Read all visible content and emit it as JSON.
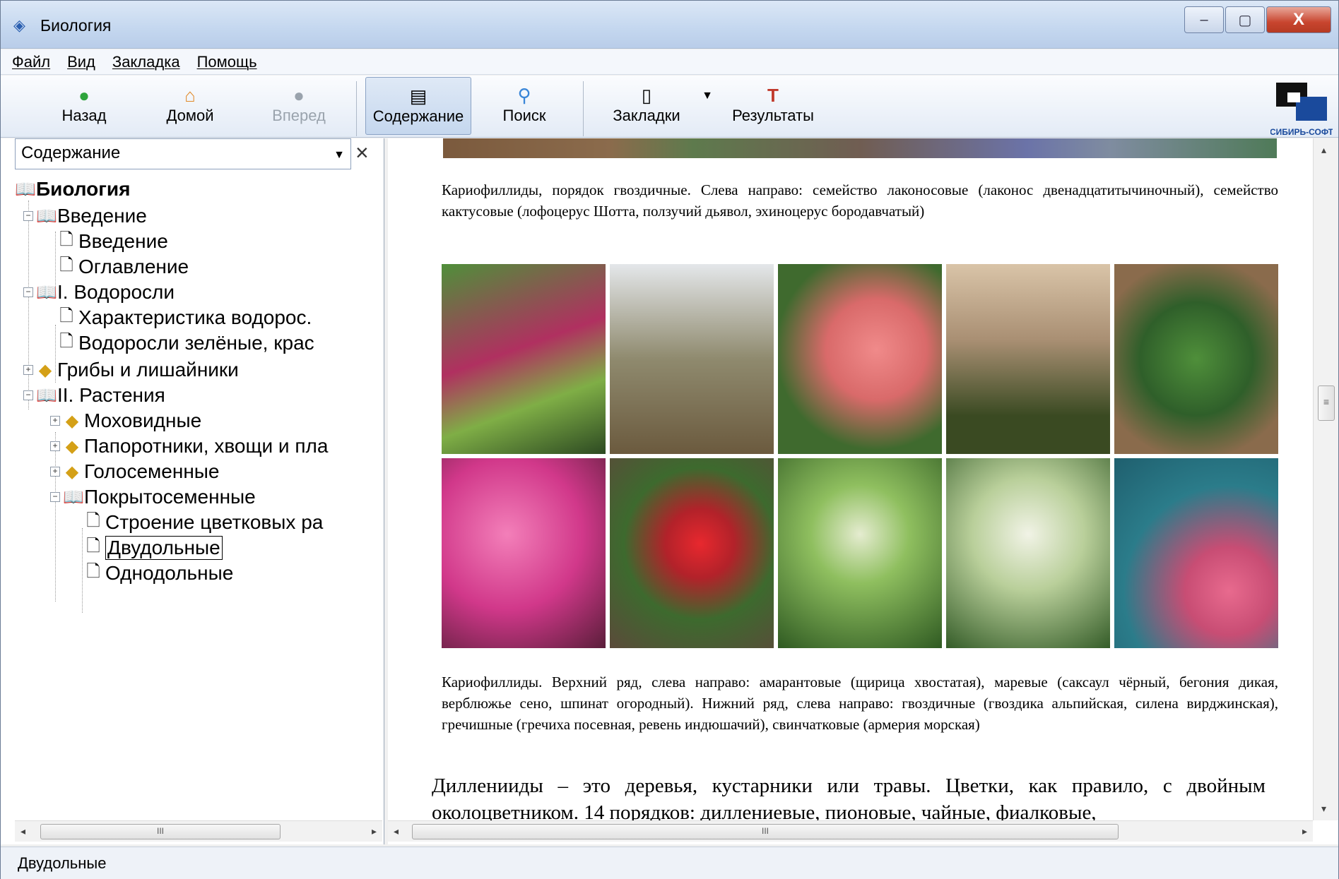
{
  "window": {
    "title": "Биология",
    "buttons": {
      "minimize": "–",
      "maximize": "▢",
      "close": "X"
    }
  },
  "menu": [
    "Файл",
    "Вид",
    "Закладка",
    "Помощь"
  ],
  "toolbar": {
    "back": "Назад",
    "home": "Домой",
    "forward": "Вперед",
    "contents": "Содержание",
    "search": "Поиск",
    "bookmarks": "Закладки",
    "results": "Результаты",
    "logo_text": "СИБИРЬ-СОФТ"
  },
  "left": {
    "combo_value": "Содержание",
    "tree": [
      "Биология",
      "Введение",
      "Введение",
      "Оглавление",
      "I. Водоросли",
      "Характеристика водорос.",
      "Водоросли зелёные, крас",
      "Грибы и лишайники",
      "II. Растения",
      "Моховидные",
      "Папоротники, хвощи и пла",
      "Голосеменные",
      "Покрытосеменные",
      "Строение цветковых ра",
      "Двудольные",
      "Однодольные"
    ]
  },
  "content": {
    "caption1": "Кариофиллиды, порядок гвоздичные. Слева направо: семейство лаконосовые (лаконос двенадцатитычиночный), семейство кактусовые (лофоцерус Шотта, ползучий дьявол, эхиноцерус бородавчатый)",
    "caption2": "Кариофиллиды. Верхний ряд, слева направо: амарантовые (щирица хвостатая), маревые (саксаул чёрный, бегония дикая, верблюжье сено, шпинат огородный). Нижний ряд, слева направо: гвоздичные (гвоздика альпийская, силена вирджинская), гречишные (гречиха посевная, ревень индюшачий), свинчатковые (армерия морская)",
    "body": "Дилленииды – это деревья, кустарники или травы. Цветки, как правило, с двойным околоцветником. 14 порядков: диллениевые, пионовые, чайные, фиалковые,"
  },
  "scroll": {
    "thumb_grip": "III",
    "vthumb_grip": "≡"
  },
  "status": "Двудольные"
}
